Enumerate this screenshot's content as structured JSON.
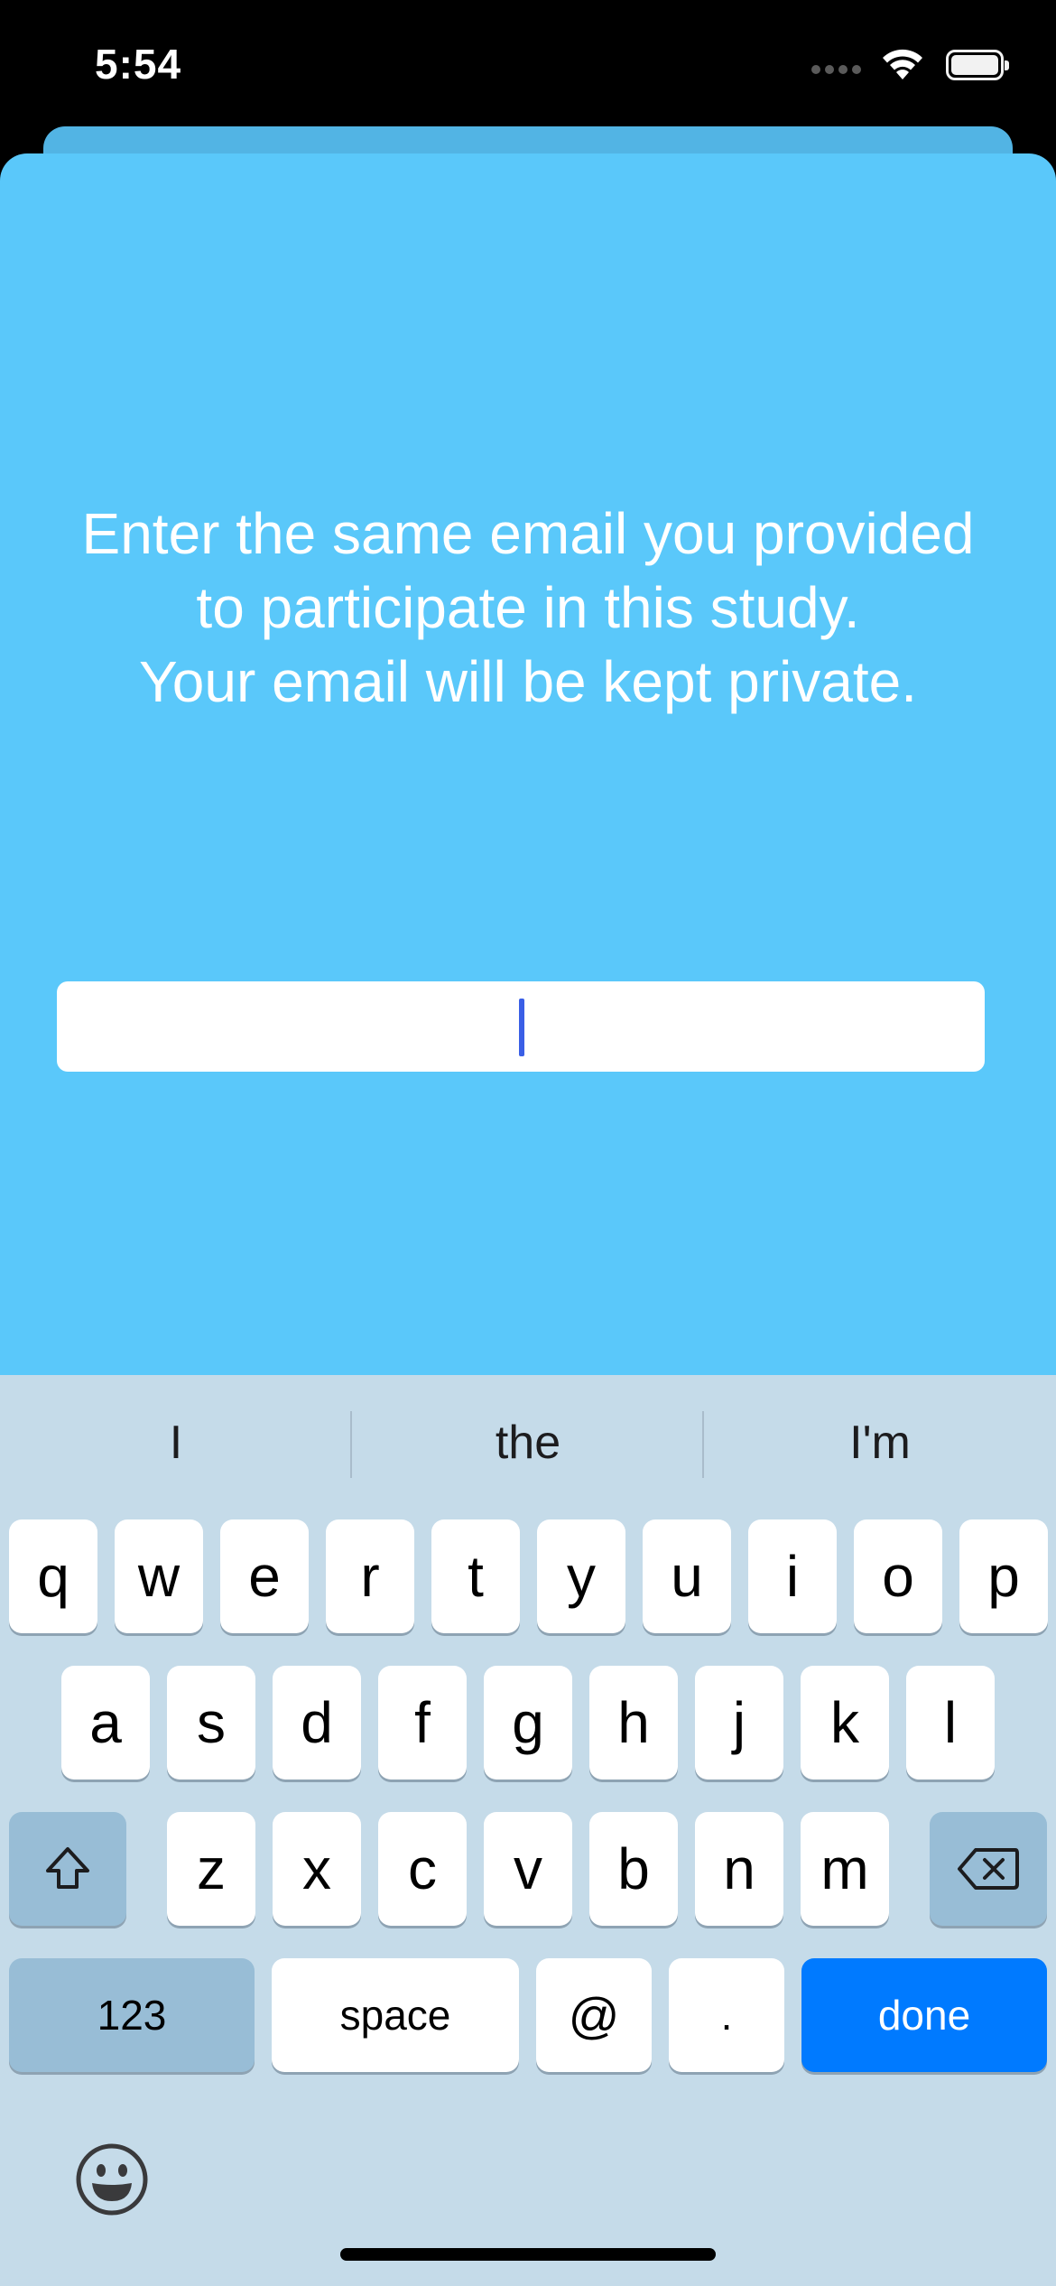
{
  "status_bar": {
    "time": "5:54"
  },
  "screen": {
    "prompt_lines": [
      "Enter the same email you provided",
      "to participate in this study.",
      "Your email will be kept private."
    ],
    "email_value": "",
    "colors": {
      "background": "#5ac8fa",
      "caret": "#3a5fe6",
      "keyboard": "#c5dbe9",
      "done_key": "#007aff"
    }
  },
  "keyboard": {
    "suggestions": [
      "I",
      "the",
      "I'm"
    ],
    "row1": [
      "q",
      "w",
      "e",
      "r",
      "t",
      "y",
      "u",
      "i",
      "o",
      "p"
    ],
    "row2": [
      "a",
      "s",
      "d",
      "f",
      "g",
      "h",
      "j",
      "k",
      "l"
    ],
    "row3": [
      "z",
      "x",
      "c",
      "v",
      "b",
      "n",
      "m"
    ],
    "bottom": {
      "numbers": "123",
      "space": "space",
      "at": "@",
      "dot": ".",
      "done": "done"
    },
    "icons": {
      "shift": "shift-icon",
      "delete": "delete-icon",
      "emoji": "emoji-icon"
    }
  }
}
